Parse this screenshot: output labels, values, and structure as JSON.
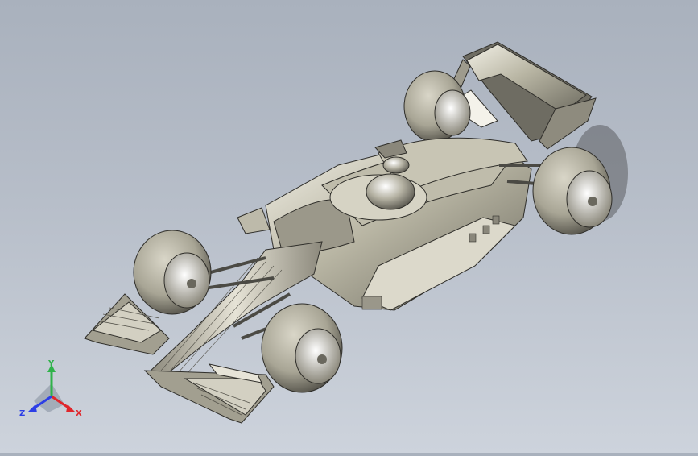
{
  "viewport": {
    "background_top": "#a9b1bd",
    "background_bottom": "#cdd3dc"
  },
  "model": {
    "icon": "formula-car-model",
    "color": "#c9c6b4"
  },
  "triad": {
    "x_label": "X",
    "y_label": "Y",
    "z_label": "Z",
    "x_color": "#e0262b",
    "y_color": "#2fb24a",
    "z_color": "#2c3ee6"
  }
}
